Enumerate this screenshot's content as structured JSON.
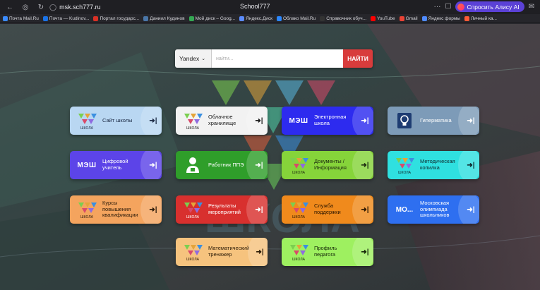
{
  "browser": {
    "url": "msk.sch777.ru",
    "window_title": "School777",
    "alice_label": "Спросить Алису AI"
  },
  "bookmarks": [
    {
      "label": "Почта Mail.Ru",
      "color": "#3b8bff"
    },
    {
      "label": "Почта — Kudinov...",
      "color": "#1a73e8"
    },
    {
      "label": "Портал государс...",
      "color": "#d93025"
    },
    {
      "label": "Даниил Кудинов",
      "color": "#4a76a8"
    },
    {
      "label": "Мой диск – Goog...",
      "color": "#34a853"
    },
    {
      "label": "Яндекс.Диск",
      "color": "#5c8cff"
    },
    {
      "label": "Облако Mail.Ru",
      "color": "#2b87ff"
    },
    {
      "label": "Справочник обуч...",
      "color": "#333333"
    },
    {
      "label": "YouTube",
      "color": "#ff0000"
    },
    {
      "label": "Gmail",
      "color": "#ea4335"
    },
    {
      "label": "Яндекс формы",
      "color": "#4f8bff"
    },
    {
      "label": "Личный ка...",
      "color": "#ff5a36"
    }
  ],
  "search": {
    "engine": "Yandex",
    "placeholder": "найти...",
    "button": "НАЙТИ"
  },
  "tiles": [
    {
      "label": "Сайт школы",
      "bg": "#b9d7f2",
      "fg": "#1c2a44",
      "logo": "school-logo"
    },
    {
      "label": "Облачное хранилище",
      "bg": "#f2f2f2",
      "fg": "#1b1b1b",
      "logo": "school-logo"
    },
    {
      "label": "Электронная школа",
      "bg": "#2d2bef",
      "fg": "#ffffff",
      "logo": "mesh-logo"
    },
    {
      "label": "Гиперматика",
      "bg": "#7d9bb8",
      "fg": "#ffffff",
      "logo": "lightbulb-logo"
    },
    {
      "label": "Цифровой учитель",
      "bg": "#5c44e8",
      "fg": "#ffffff",
      "logo": "mesh-logo"
    },
    {
      "label": "Работник ППЭ",
      "bg": "#2f9e2a",
      "fg": "#ffffff",
      "logo": "worker-logo"
    },
    {
      "label": "Документы / Информация",
      "bg": "#86d43a",
      "fg": "#1d2a10",
      "logo": "school-logo"
    },
    {
      "label": "Методическая копилка",
      "bg": "#2fe0e0",
      "fg": "#0f2a2e",
      "logo": "school-logo"
    },
    {
      "label": "Курсы повышения квалификации",
      "bg": "#f4a45e",
      "fg": "#2a1a0a",
      "logo": "school-logo"
    },
    {
      "label": "Результаты мероприятий",
      "bg": "#d8302e",
      "fg": "#ffffff",
      "logo": "school-logo"
    },
    {
      "label": "Служба поддержки",
      "bg": "#f08a1c",
      "fg": "#2a1600",
      "logo": "school-logo"
    },
    {
      "label": "Московская олимпиада школьников",
      "bg": "#2e6ff0",
      "fg": "#ffffff",
      "logo": "mo-logo"
    },
    {
      "label": "Математический тренажер",
      "bg": "#f6c37e",
      "fg": "#2a1a06",
      "logo": "school-logo"
    },
    {
      "label": "Профиль педагога",
      "bg": "#9ef060",
      "fg": "#16280a",
      "logo": "school-logo"
    }
  ],
  "mesh_text": "МЭШ",
  "mo_text": "МО...",
  "school_logo_caption": "ШКОЛА"
}
